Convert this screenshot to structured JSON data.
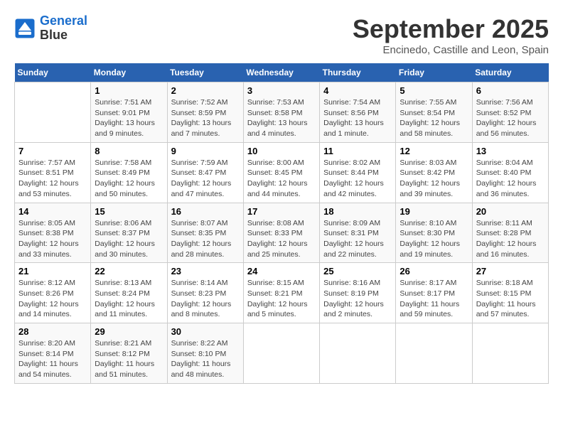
{
  "logo": {
    "line1": "General",
    "line2": "Blue"
  },
  "title": "September 2025",
  "location": "Encinedo, Castille and Leon, Spain",
  "weekdays": [
    "Sunday",
    "Monday",
    "Tuesday",
    "Wednesday",
    "Thursday",
    "Friday",
    "Saturday"
  ],
  "weeks": [
    [
      {
        "day": "",
        "info": ""
      },
      {
        "day": "1",
        "info": "Sunrise: 7:51 AM\nSunset: 9:01 PM\nDaylight: 13 hours\nand 9 minutes."
      },
      {
        "day": "2",
        "info": "Sunrise: 7:52 AM\nSunset: 8:59 PM\nDaylight: 13 hours\nand 7 minutes."
      },
      {
        "day": "3",
        "info": "Sunrise: 7:53 AM\nSunset: 8:58 PM\nDaylight: 13 hours\nand 4 minutes."
      },
      {
        "day": "4",
        "info": "Sunrise: 7:54 AM\nSunset: 8:56 PM\nDaylight: 13 hours\nand 1 minute."
      },
      {
        "day": "5",
        "info": "Sunrise: 7:55 AM\nSunset: 8:54 PM\nDaylight: 12 hours\nand 58 minutes."
      },
      {
        "day": "6",
        "info": "Sunrise: 7:56 AM\nSunset: 8:52 PM\nDaylight: 12 hours\nand 56 minutes."
      }
    ],
    [
      {
        "day": "7",
        "info": "Sunrise: 7:57 AM\nSunset: 8:51 PM\nDaylight: 12 hours\nand 53 minutes."
      },
      {
        "day": "8",
        "info": "Sunrise: 7:58 AM\nSunset: 8:49 PM\nDaylight: 12 hours\nand 50 minutes."
      },
      {
        "day": "9",
        "info": "Sunrise: 7:59 AM\nSunset: 8:47 PM\nDaylight: 12 hours\nand 47 minutes."
      },
      {
        "day": "10",
        "info": "Sunrise: 8:00 AM\nSunset: 8:45 PM\nDaylight: 12 hours\nand 44 minutes."
      },
      {
        "day": "11",
        "info": "Sunrise: 8:02 AM\nSunset: 8:44 PM\nDaylight: 12 hours\nand 42 minutes."
      },
      {
        "day": "12",
        "info": "Sunrise: 8:03 AM\nSunset: 8:42 PM\nDaylight: 12 hours\nand 39 minutes."
      },
      {
        "day": "13",
        "info": "Sunrise: 8:04 AM\nSunset: 8:40 PM\nDaylight: 12 hours\nand 36 minutes."
      }
    ],
    [
      {
        "day": "14",
        "info": "Sunrise: 8:05 AM\nSunset: 8:38 PM\nDaylight: 12 hours\nand 33 minutes."
      },
      {
        "day": "15",
        "info": "Sunrise: 8:06 AM\nSunset: 8:37 PM\nDaylight: 12 hours\nand 30 minutes."
      },
      {
        "day": "16",
        "info": "Sunrise: 8:07 AM\nSunset: 8:35 PM\nDaylight: 12 hours\nand 28 minutes."
      },
      {
        "day": "17",
        "info": "Sunrise: 8:08 AM\nSunset: 8:33 PM\nDaylight: 12 hours\nand 25 minutes."
      },
      {
        "day": "18",
        "info": "Sunrise: 8:09 AM\nSunset: 8:31 PM\nDaylight: 12 hours\nand 22 minutes."
      },
      {
        "day": "19",
        "info": "Sunrise: 8:10 AM\nSunset: 8:30 PM\nDaylight: 12 hours\nand 19 minutes."
      },
      {
        "day": "20",
        "info": "Sunrise: 8:11 AM\nSunset: 8:28 PM\nDaylight: 12 hours\nand 16 minutes."
      }
    ],
    [
      {
        "day": "21",
        "info": "Sunrise: 8:12 AM\nSunset: 8:26 PM\nDaylight: 12 hours\nand 14 minutes."
      },
      {
        "day": "22",
        "info": "Sunrise: 8:13 AM\nSunset: 8:24 PM\nDaylight: 12 hours\nand 11 minutes."
      },
      {
        "day": "23",
        "info": "Sunrise: 8:14 AM\nSunset: 8:23 PM\nDaylight: 12 hours\nand 8 minutes."
      },
      {
        "day": "24",
        "info": "Sunrise: 8:15 AM\nSunset: 8:21 PM\nDaylight: 12 hours\nand 5 minutes."
      },
      {
        "day": "25",
        "info": "Sunrise: 8:16 AM\nSunset: 8:19 PM\nDaylight: 12 hours\nand 2 minutes."
      },
      {
        "day": "26",
        "info": "Sunrise: 8:17 AM\nSunset: 8:17 PM\nDaylight: 11 hours\nand 59 minutes."
      },
      {
        "day": "27",
        "info": "Sunrise: 8:18 AM\nSunset: 8:15 PM\nDaylight: 11 hours\nand 57 minutes."
      }
    ],
    [
      {
        "day": "28",
        "info": "Sunrise: 8:20 AM\nSunset: 8:14 PM\nDaylight: 11 hours\nand 54 minutes."
      },
      {
        "day": "29",
        "info": "Sunrise: 8:21 AM\nSunset: 8:12 PM\nDaylight: 11 hours\nand 51 minutes."
      },
      {
        "day": "30",
        "info": "Sunrise: 8:22 AM\nSunset: 8:10 PM\nDaylight: 11 hours\nand 48 minutes."
      },
      {
        "day": "",
        "info": ""
      },
      {
        "day": "",
        "info": ""
      },
      {
        "day": "",
        "info": ""
      },
      {
        "day": "",
        "info": ""
      }
    ]
  ]
}
